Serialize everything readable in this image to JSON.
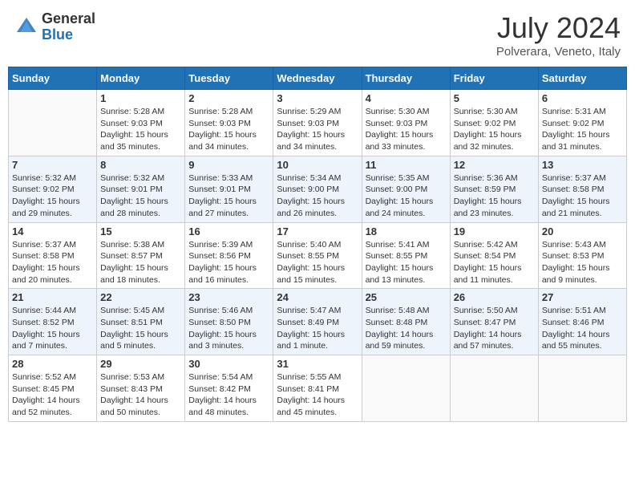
{
  "header": {
    "logo_general": "General",
    "logo_blue": "Blue",
    "title": "July 2024",
    "location": "Polverara, Veneto, Italy"
  },
  "days_of_week": [
    "Sunday",
    "Monday",
    "Tuesday",
    "Wednesday",
    "Thursday",
    "Friday",
    "Saturday"
  ],
  "weeks": [
    {
      "days": [
        {
          "num": "",
          "info": ""
        },
        {
          "num": "1",
          "info": "Sunrise: 5:28 AM\nSunset: 9:03 PM\nDaylight: 15 hours\nand 35 minutes."
        },
        {
          "num": "2",
          "info": "Sunrise: 5:28 AM\nSunset: 9:03 PM\nDaylight: 15 hours\nand 34 minutes."
        },
        {
          "num": "3",
          "info": "Sunrise: 5:29 AM\nSunset: 9:03 PM\nDaylight: 15 hours\nand 34 minutes."
        },
        {
          "num": "4",
          "info": "Sunrise: 5:30 AM\nSunset: 9:03 PM\nDaylight: 15 hours\nand 33 minutes."
        },
        {
          "num": "5",
          "info": "Sunrise: 5:30 AM\nSunset: 9:02 PM\nDaylight: 15 hours\nand 32 minutes."
        },
        {
          "num": "6",
          "info": "Sunrise: 5:31 AM\nSunset: 9:02 PM\nDaylight: 15 hours\nand 31 minutes."
        }
      ],
      "alt": false
    },
    {
      "days": [
        {
          "num": "7",
          "info": "Sunrise: 5:32 AM\nSunset: 9:02 PM\nDaylight: 15 hours\nand 29 minutes."
        },
        {
          "num": "8",
          "info": "Sunrise: 5:32 AM\nSunset: 9:01 PM\nDaylight: 15 hours\nand 28 minutes."
        },
        {
          "num": "9",
          "info": "Sunrise: 5:33 AM\nSunset: 9:01 PM\nDaylight: 15 hours\nand 27 minutes."
        },
        {
          "num": "10",
          "info": "Sunrise: 5:34 AM\nSunset: 9:00 PM\nDaylight: 15 hours\nand 26 minutes."
        },
        {
          "num": "11",
          "info": "Sunrise: 5:35 AM\nSunset: 9:00 PM\nDaylight: 15 hours\nand 24 minutes."
        },
        {
          "num": "12",
          "info": "Sunrise: 5:36 AM\nSunset: 8:59 PM\nDaylight: 15 hours\nand 23 minutes."
        },
        {
          "num": "13",
          "info": "Sunrise: 5:37 AM\nSunset: 8:58 PM\nDaylight: 15 hours\nand 21 minutes."
        }
      ],
      "alt": true
    },
    {
      "days": [
        {
          "num": "14",
          "info": "Sunrise: 5:37 AM\nSunset: 8:58 PM\nDaylight: 15 hours\nand 20 minutes."
        },
        {
          "num": "15",
          "info": "Sunrise: 5:38 AM\nSunset: 8:57 PM\nDaylight: 15 hours\nand 18 minutes."
        },
        {
          "num": "16",
          "info": "Sunrise: 5:39 AM\nSunset: 8:56 PM\nDaylight: 15 hours\nand 16 minutes."
        },
        {
          "num": "17",
          "info": "Sunrise: 5:40 AM\nSunset: 8:55 PM\nDaylight: 15 hours\nand 15 minutes."
        },
        {
          "num": "18",
          "info": "Sunrise: 5:41 AM\nSunset: 8:55 PM\nDaylight: 15 hours\nand 13 minutes."
        },
        {
          "num": "19",
          "info": "Sunrise: 5:42 AM\nSunset: 8:54 PM\nDaylight: 15 hours\nand 11 minutes."
        },
        {
          "num": "20",
          "info": "Sunrise: 5:43 AM\nSunset: 8:53 PM\nDaylight: 15 hours\nand 9 minutes."
        }
      ],
      "alt": false
    },
    {
      "days": [
        {
          "num": "21",
          "info": "Sunrise: 5:44 AM\nSunset: 8:52 PM\nDaylight: 15 hours\nand 7 minutes."
        },
        {
          "num": "22",
          "info": "Sunrise: 5:45 AM\nSunset: 8:51 PM\nDaylight: 15 hours\nand 5 minutes."
        },
        {
          "num": "23",
          "info": "Sunrise: 5:46 AM\nSunset: 8:50 PM\nDaylight: 15 hours\nand 3 minutes."
        },
        {
          "num": "24",
          "info": "Sunrise: 5:47 AM\nSunset: 8:49 PM\nDaylight: 15 hours\nand 1 minute."
        },
        {
          "num": "25",
          "info": "Sunrise: 5:48 AM\nSunset: 8:48 PM\nDaylight: 14 hours\nand 59 minutes."
        },
        {
          "num": "26",
          "info": "Sunrise: 5:50 AM\nSunset: 8:47 PM\nDaylight: 14 hours\nand 57 minutes."
        },
        {
          "num": "27",
          "info": "Sunrise: 5:51 AM\nSunset: 8:46 PM\nDaylight: 14 hours\nand 55 minutes."
        }
      ],
      "alt": true
    },
    {
      "days": [
        {
          "num": "28",
          "info": "Sunrise: 5:52 AM\nSunset: 8:45 PM\nDaylight: 14 hours\nand 52 minutes."
        },
        {
          "num": "29",
          "info": "Sunrise: 5:53 AM\nSunset: 8:43 PM\nDaylight: 14 hours\nand 50 minutes."
        },
        {
          "num": "30",
          "info": "Sunrise: 5:54 AM\nSunset: 8:42 PM\nDaylight: 14 hours\nand 48 minutes."
        },
        {
          "num": "31",
          "info": "Sunrise: 5:55 AM\nSunset: 8:41 PM\nDaylight: 14 hours\nand 45 minutes."
        },
        {
          "num": "",
          "info": ""
        },
        {
          "num": "",
          "info": ""
        },
        {
          "num": "",
          "info": ""
        }
      ],
      "alt": false
    }
  ]
}
